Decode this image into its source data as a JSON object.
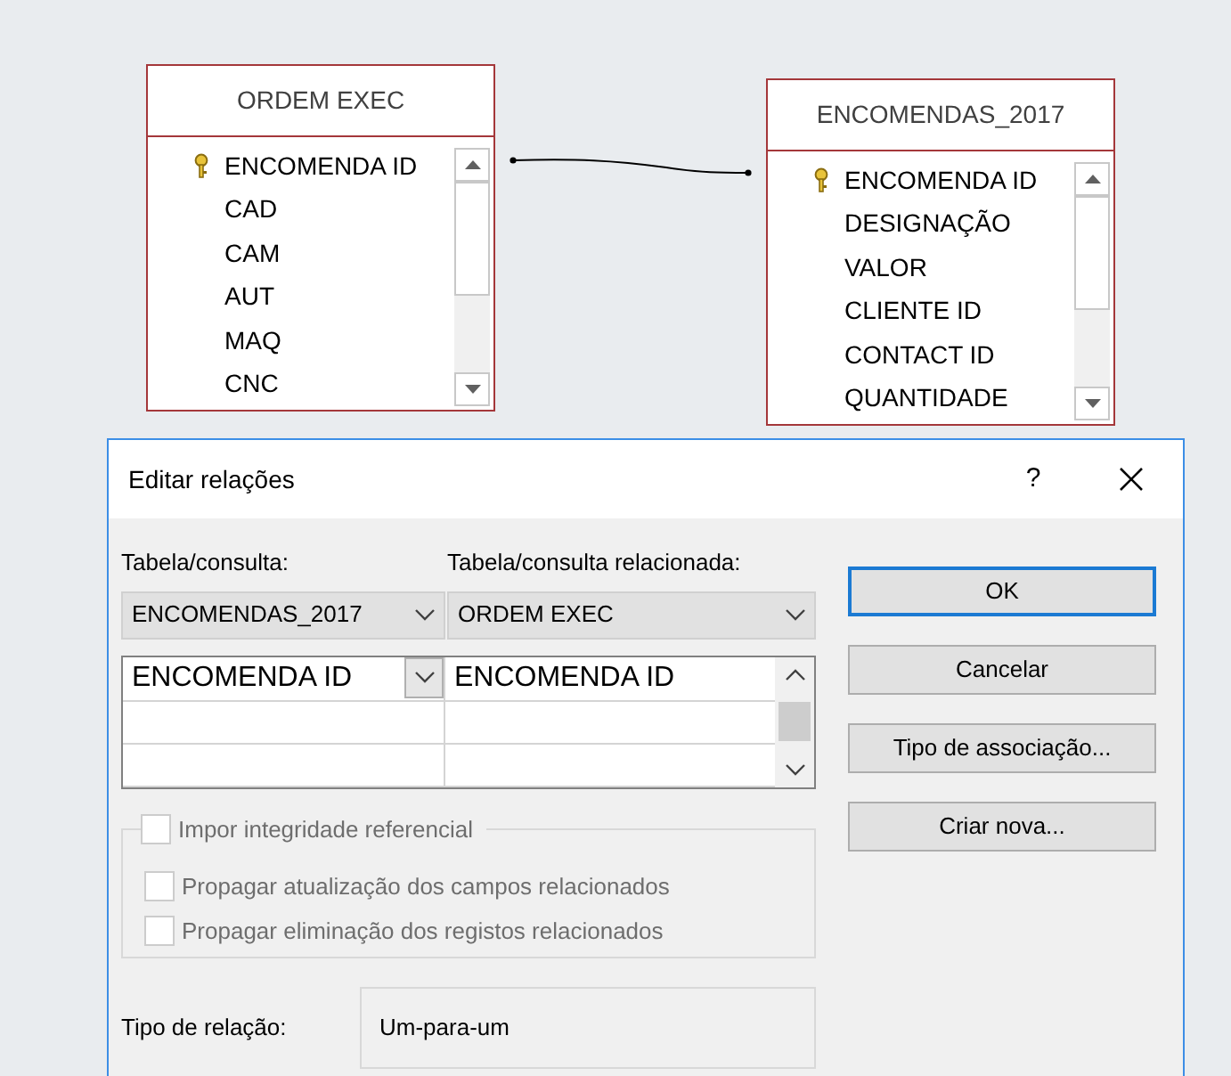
{
  "tables": [
    {
      "title": "ORDEM EXEC",
      "fields": [
        {
          "name": "ENCOMENDA ID",
          "key": true
        },
        {
          "name": "CAD",
          "key": false
        },
        {
          "name": "CAM",
          "key": false
        },
        {
          "name": "AUT",
          "key": false
        },
        {
          "name": "MAQ",
          "key": false
        },
        {
          "name": "CNC",
          "key": false
        }
      ]
    },
    {
      "title": "ENCOMENDAS_2017",
      "fields": [
        {
          "name": "ENCOMENDA ID",
          "key": true
        },
        {
          "name": "DESIGNAÇÃO",
          "key": false
        },
        {
          "name": "VALOR",
          "key": false
        },
        {
          "name": "CLIENTE ID",
          "key": false
        },
        {
          "name": "CONTACT ID",
          "key": false
        },
        {
          "name": "QUANTIDADE",
          "key": false
        }
      ]
    }
  ],
  "dialog": {
    "title": "Editar relações",
    "help": "?",
    "table_label": "Tabela/consulta:",
    "related_label": "Tabela/consulta relacionada:",
    "table_value": "ENCOMENDAS_2017",
    "related_value": "ORDEM EXEC",
    "grid_rows": [
      {
        "left": "ENCOMENDA ID",
        "right": "ENCOMENDA ID"
      }
    ],
    "options": [
      {
        "label": "Impor integridade referencial",
        "checked": false,
        "disabled": true
      },
      {
        "label": "Propagar atualização dos campos relacionados",
        "checked": false,
        "disabled": true
      },
      {
        "label": "Propagar eliminação dos registos relacionados",
        "checked": false,
        "disabled": true
      }
    ],
    "relation_label": "Tipo de relação:",
    "relation_value": "Um-para-um",
    "buttons": [
      {
        "label": "OK",
        "default": true
      },
      {
        "label": "Cancelar",
        "default": false
      },
      {
        "label": "Tipo de associação...",
        "default": false
      },
      {
        "label": "Criar nova...",
        "default": false
      }
    ]
  }
}
